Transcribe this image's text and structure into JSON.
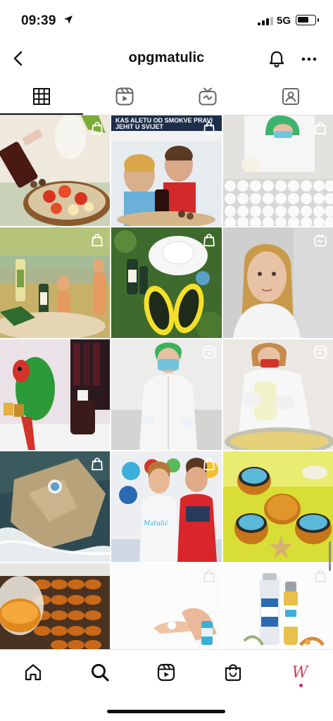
{
  "status_bar": {
    "time": "09:39",
    "network": "5G",
    "battery_level": 0.7
  },
  "header": {
    "username": "opgmatulic"
  },
  "tabs": [
    {
      "name": "grid",
      "icon": "grid-icon",
      "active": true
    },
    {
      "name": "reels",
      "icon": "reels-icon",
      "active": false
    },
    {
      "name": "igtv",
      "icon": "igtv-icon",
      "active": false
    },
    {
      "name": "tagged",
      "icon": "tagged-icon",
      "active": false
    }
  ],
  "posts": [
    {
      "badge": "shopping-bag-icon",
      "subject": "sauce bottle over tomato salad"
    },
    {
      "badge": "shopping-bag-icon",
      "subject": "newspaper clipping with couple",
      "caption": "KAS ALETU OD SMOKVE PRAVI JEHIT U SVIJET"
    },
    {
      "badge": "shopping-bag-icon",
      "subject": "worker filling jars"
    },
    {
      "badge": "shopping-bag-icon",
      "subject": "bottles on rock by the sea"
    },
    {
      "badge": "shopping-bag-icon",
      "subject": "hat and yellow flip flops on grass"
    },
    {
      "badge": "igtv-icon",
      "subject": "woman portrait"
    },
    {
      "badge": "",
      "subject": "parrot next to products"
    },
    {
      "badge": "reels-icon",
      "subject": "woman in lab coat"
    },
    {
      "badge": "reels-icon",
      "subject": "pouring into jar"
    },
    {
      "badge": "shopping-bag-icon",
      "subject": "jar on stone by water"
    },
    {
      "badge": "shopping-bag-icon",
      "subject": "couple in front of display",
      "caption": "Matulić"
    },
    {
      "badge": "shopping-bag-icon",
      "subject": "jars with starfish"
    },
    {
      "badge": "",
      "subject": "honey jars tray"
    },
    {
      "badge": "shopping-bag-icon",
      "subject": "hands with cream"
    },
    {
      "badge": "shopping-bag-icon",
      "subject": "product bottles"
    }
  ],
  "bottom_nav": [
    {
      "name": "home",
      "icon": "home-icon"
    },
    {
      "name": "search",
      "icon": "search-icon",
      "active": true
    },
    {
      "name": "reels",
      "icon": "reels-icon"
    },
    {
      "name": "shop",
      "icon": "shop-icon"
    },
    {
      "name": "profile",
      "icon": "profile-avatar"
    }
  ],
  "colors": {
    "accent": "#e0245e",
    "text": "#111111",
    "divider": "#dbdbdb"
  }
}
